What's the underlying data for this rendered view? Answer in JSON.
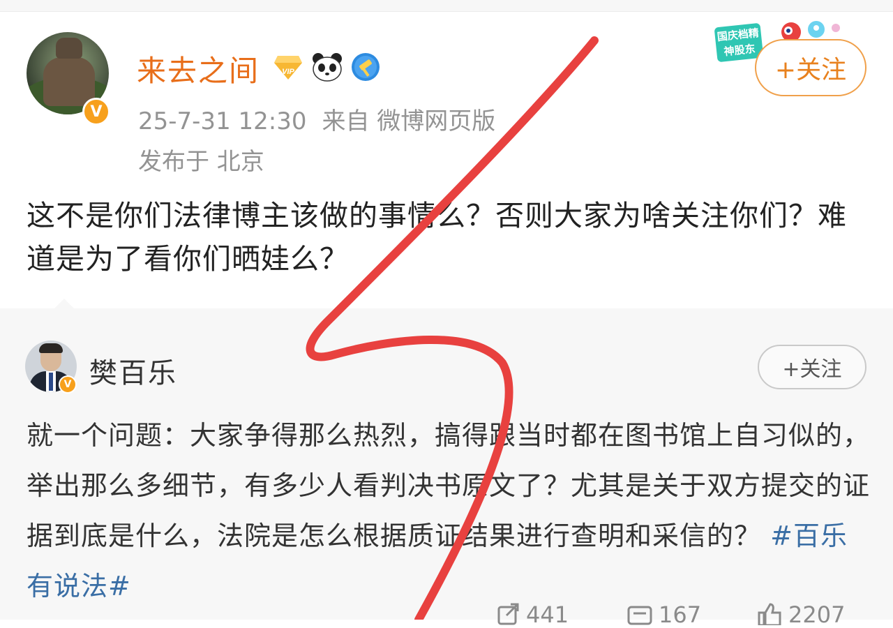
{
  "main_post": {
    "username": "来去之间",
    "timestamp": "25-7-31 12:30",
    "source": "来自 微博网页版",
    "location": "发布于 北京",
    "follow_label": "+关注",
    "content": "这不是你们法律博主该做的事情么？否则大家为啥关注你们？难道是为了看你们晒娃么？",
    "badges": [
      "vip-icon",
      "panda-icon",
      "shield-icon"
    ],
    "promo_text": "国庆档精神股东"
  },
  "repost": {
    "username": "樊百乐",
    "follow_label": "+关注",
    "content": "就一个问题：大家争得那么热烈，搞得跟当时都在图书馆上自习似的，举出那么多细节，有多少人看判决书原文了？尤其是关于双方提交的证据到底是什么，法院是怎么根据质证结果进行查明和采信的？",
    "hashtag": "#百乐有说法#"
  },
  "actions": {
    "repost_count": "441",
    "comment_count": "167",
    "like_count": "2207"
  },
  "colors": {
    "username_orange": "#e86e1a",
    "follow_orange": "#f0a04a",
    "hashtag_blue": "#3a6ea5",
    "scribble_red": "#e8413f",
    "meta_gray": "#939393"
  }
}
